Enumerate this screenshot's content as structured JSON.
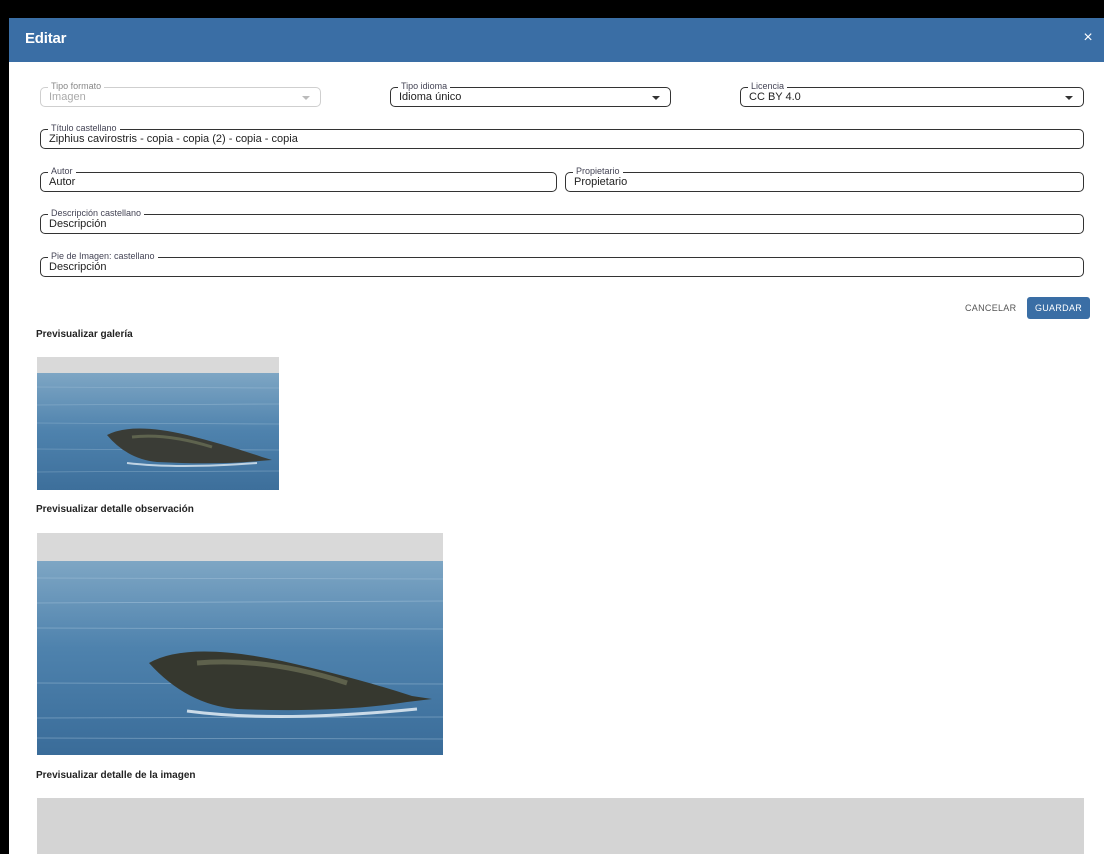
{
  "dialog": {
    "title": "Editar",
    "close_symbol": "×"
  },
  "form": {
    "tipo_formato": {
      "label": "Tipo formato",
      "value": "Imagen"
    },
    "tipo_idioma": {
      "label": "Tipo idioma",
      "value": "Idioma único"
    },
    "licencia": {
      "label": "Licencia",
      "value": "CC BY 4.0"
    },
    "titulo": {
      "label": "Título castellano",
      "value": "Ziphius cavirostris - copia - copia (2) - copia - copia"
    },
    "autor": {
      "label": "Autor",
      "value": "Autor"
    },
    "propietario": {
      "label": "Propietario",
      "value": "Propietario"
    },
    "descripcion": {
      "label": "Descripción castellano",
      "value": "Descripción"
    },
    "pie_imagen": {
      "label": "Pie de Imagen: castellano",
      "value": "Descripción"
    }
  },
  "actions": {
    "cancel_label": "CANCELAR",
    "save_label": "GUARDAR"
  },
  "previews": {
    "gallery_label": "Previsualizar galería",
    "observation_label": "Previsualizar detalle observación",
    "image_label": "Previsualizar detalle de la imagen"
  },
  "colors": {
    "header": "#3a6ea5",
    "primary_button": "#3a6ea5"
  }
}
